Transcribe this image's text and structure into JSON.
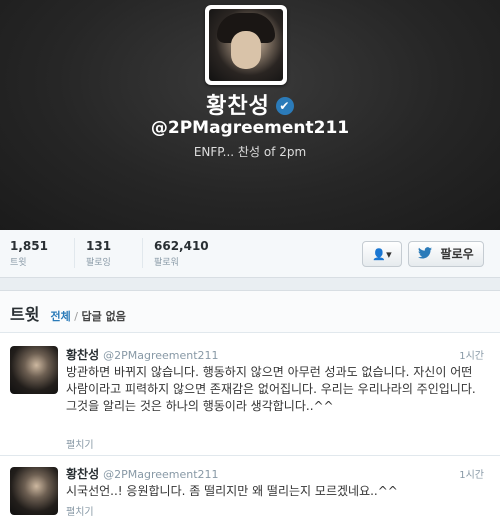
{
  "profile": {
    "name": "황찬성",
    "verified_glyph": "✔",
    "handle": "@2PMagreement211",
    "bio": "ENFP... 찬성 of 2pm"
  },
  "stats": [
    {
      "value": "1,851",
      "label": "트윗"
    },
    {
      "value": "131",
      "label": "팔로잉"
    },
    {
      "value": "662,410",
      "label": "팔로워"
    }
  ],
  "actions": {
    "user_menu_icon": "person-dropdown-icon",
    "user_menu_glyph": "👤▾",
    "follow_label": "팔로우",
    "follow_icon": "twitter-bird-icon"
  },
  "tweets_section": {
    "title": "트윗",
    "filter_all": "전체",
    "filter_sep": "/",
    "filter_no_replies": "답글 없음"
  },
  "tweets": [
    {
      "name": "황찬성",
      "handle": "@2PMagreement211",
      "time": "1시간",
      "text": "방관하면 바뀌지 않습니다. 행동하지 않으면 아무런 성과도 없습니다. 자신이 어떤 사람이라고 피력하지 않으면 존재감은 없어집니다. 우리는 우리나라의 주인입니다. 그것을 알리는 것은 하나의 행동이라 생각합니다..^^",
      "expand": "펼치기"
    },
    {
      "name": "황찬성",
      "handle": "@2PMagreement211",
      "time": "1시간",
      "text": "시국선언..! 응원합니다. 좀 떨리지만 왜 떨리는지 모르겠네요..^^",
      "expand": "펼치기"
    }
  ],
  "colors": {
    "accent": "#2b7bb9",
    "header_bg": "#262626",
    "muted": "#8899a6"
  }
}
